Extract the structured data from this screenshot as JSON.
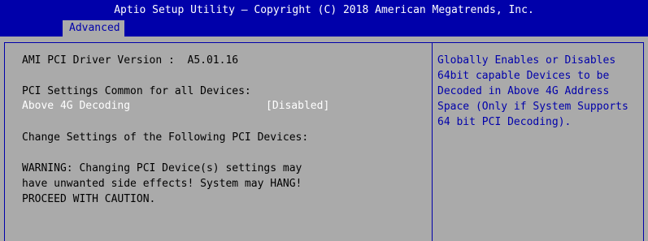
{
  "header": {
    "title": "Aptio Setup Utility – Copyright (C) 2018 American Megatrends, Inc.",
    "tab_label": "Advanced"
  },
  "main": {
    "driver_version": "AMI PCI Driver Version :  A5.01.16",
    "settings_heading": "PCI Settings Common for all Devices:",
    "option_label": "Above 4G Decoding",
    "option_value": "[Disabled]",
    "change_heading": "Change Settings of the Following PCI Devices:",
    "warning_lines": [
      "WARNING: Changing PCI Device(s) settings may",
      "have unwanted side effects! System may HANG!",
      "PROCEED WITH CAUTION."
    ]
  },
  "help": {
    "lines": [
      "Globally Enables or Disables",
      "64bit capable Devices to be",
      "Decoded in Above 4G Address",
      "Space (Only if System Supports",
      "64 bit PCI Decoding)."
    ]
  },
  "colors": {
    "header_bg": "#0000aa",
    "body_bg": "#aaaaaa",
    "help_text": "#0000aa",
    "selected_text": "#ffffff"
  }
}
